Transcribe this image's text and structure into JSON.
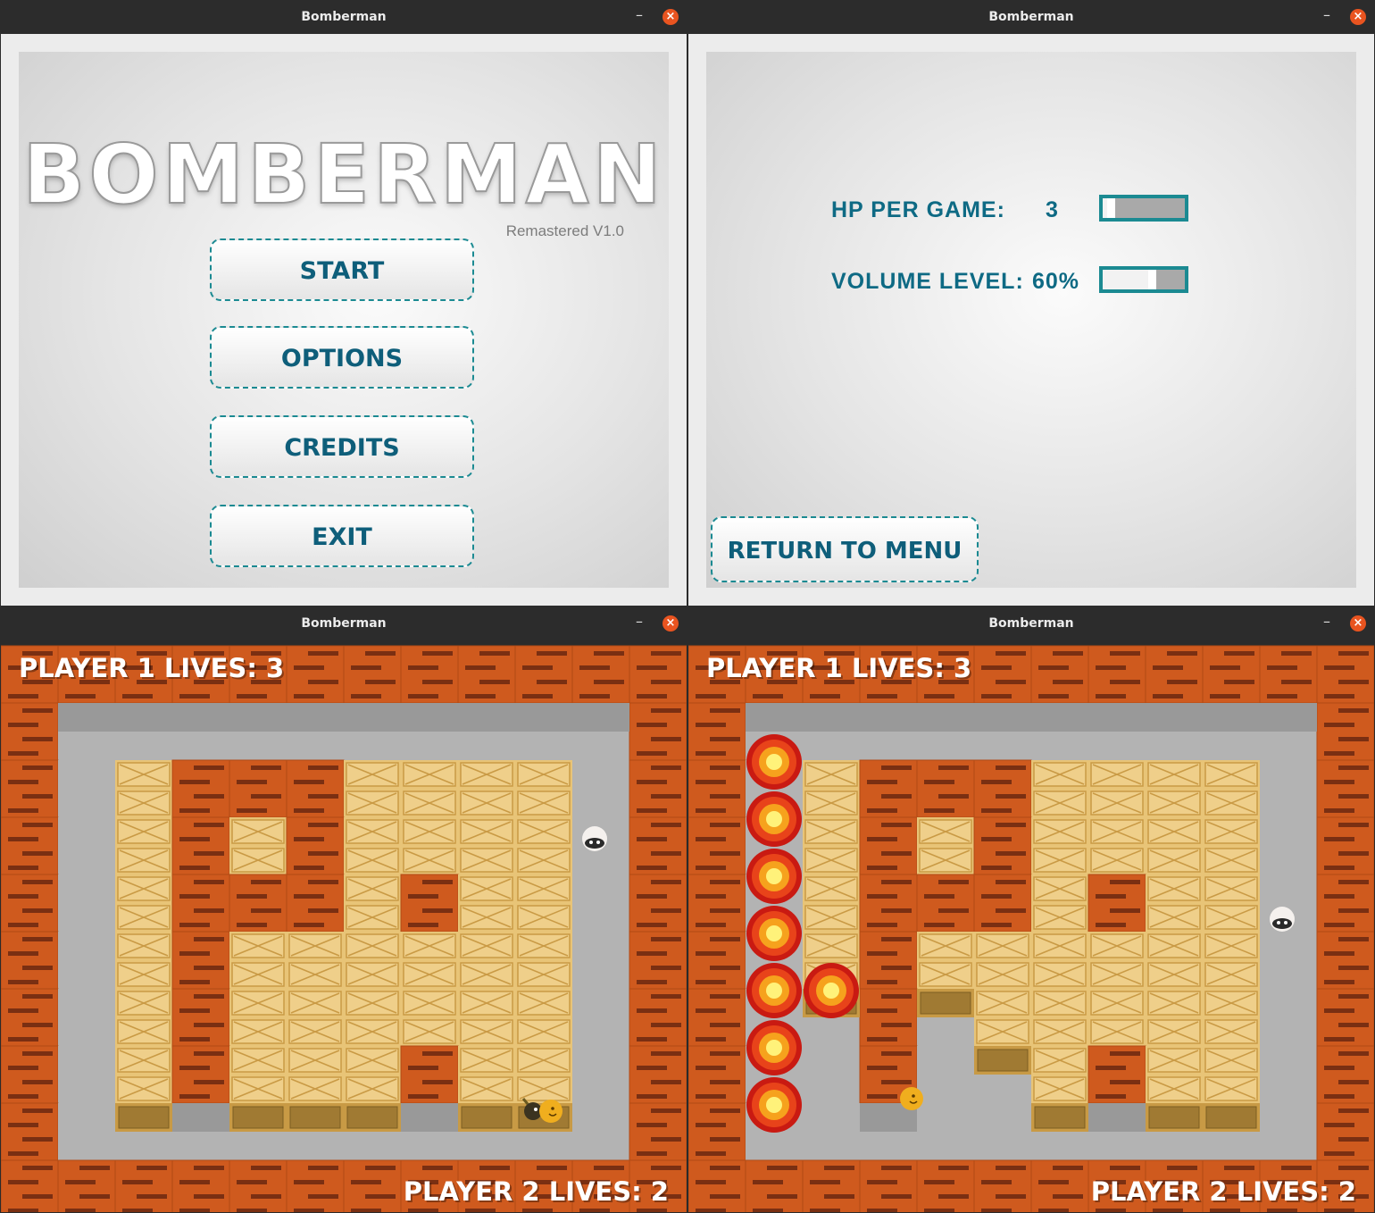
{
  "window_title": "Bomberman",
  "title_controls": {
    "minimize": "–",
    "close": "×"
  },
  "menu": {
    "logo": "BOMBERMAN",
    "subtitle": "Remastered V1.0",
    "buttons": [
      "START",
      "OPTIONS",
      "CREDITS",
      "EXIT"
    ]
  },
  "options": {
    "hp_label": "HP PER GAME:",
    "hp_value": "3",
    "hp_slider_fraction": 0.1,
    "volume_label": "VOLUME LEVEL:",
    "volume_value": "60%",
    "volume_slider_fraction": 0.6,
    "return_button": "RETURN TO MENU"
  },
  "game1": {
    "p1_label": "PLAYER 1 LIVES: 3",
    "p2_label": "PLAYER 2 LIVES: 2"
  },
  "game2": {
    "p1_label": "PLAYER 1 LIVES: 3",
    "p2_label": "PLAYER 2 LIVES: 2"
  },
  "colors": {
    "accent": "#1b8a92",
    "button_text": "#0e5e7a",
    "brick": "#cf5a1e",
    "floor": "#b3b3b3",
    "crate": "#e8c477",
    "close_button": "#e95420"
  }
}
